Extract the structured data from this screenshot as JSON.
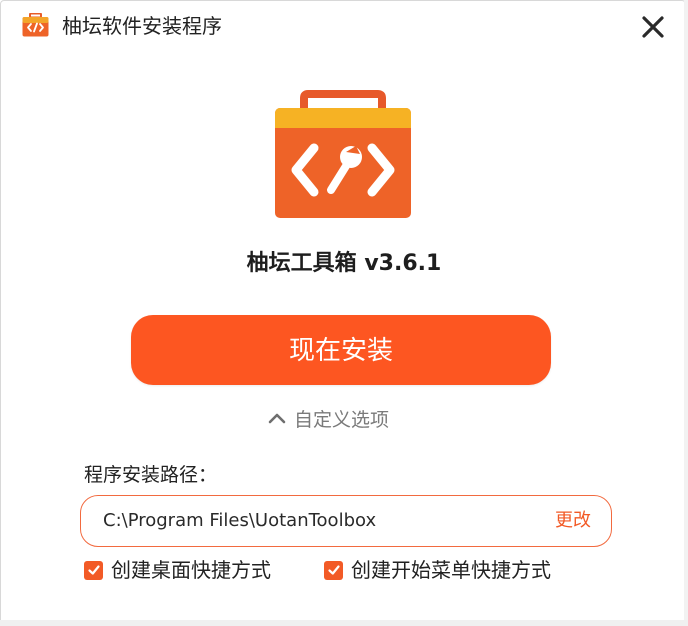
{
  "window": {
    "title": "柚坛软件安装程序",
    "icons": {
      "app": "toolbox-code-icon",
      "close": "close-icon",
      "hero": "toolbox-wrench-code-icon",
      "toggle": "chevron-up-icon",
      "checkbox": "checkmark-icon"
    }
  },
  "product": {
    "name": "柚坛工具箱 v3.6.1"
  },
  "install": {
    "button_label": "现在安装"
  },
  "custom": {
    "toggle_label": "自定义选项",
    "path_label": "程序安装路径：",
    "path_value": "C:\\Program Files\\UotanToolbox",
    "change_label": "更改",
    "options": [
      {
        "label": "创建桌面快捷方式",
        "checked": true
      },
      {
        "label": "创建开始菜单快捷方式",
        "checked": true
      }
    ]
  },
  "colors": {
    "accent": "#fd5621",
    "icon_top": "#f5b423",
    "icon_body": "#ee6328"
  }
}
